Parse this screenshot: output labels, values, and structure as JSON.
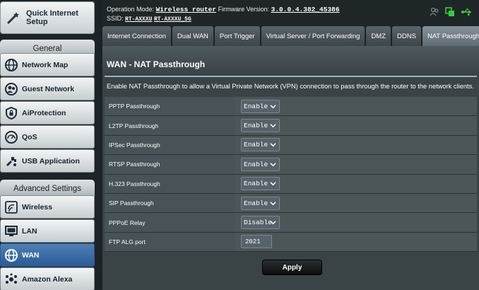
{
  "header": {
    "operation_mode_label": "Operation Mode:",
    "operation_mode_value": "Wireless router",
    "firmware_label": "Firmware Version:",
    "firmware_value": "3.0.0.4.382_45386",
    "ssid_label": "SSID:",
    "ssid_1": "RT-AXXXU",
    "ssid_2": "RT-AXXXU_5G"
  },
  "sidebar": {
    "quick_setup": "Quick Internet Setup",
    "general_title": "General",
    "general_items": [
      {
        "label": "Network Map",
        "icon": "globe-icon"
      },
      {
        "label": "Guest Network",
        "icon": "guest-network-icon"
      },
      {
        "label": "AiProtection",
        "icon": "lock-shield-icon"
      },
      {
        "label": "QoS",
        "icon": "speedometer-icon"
      },
      {
        "label": "USB Application",
        "icon": "puzzle-icon"
      }
    ],
    "advanced_title": "Advanced Settings",
    "advanced_items": [
      {
        "label": "Wireless",
        "icon": "wireless-icon"
      },
      {
        "label": "LAN",
        "icon": "monitor-icon"
      },
      {
        "label": "WAN",
        "icon": "globe-icon",
        "active": true
      },
      {
        "label": "Amazon Alexa",
        "icon": "alexa-icon"
      }
    ]
  },
  "tabs": [
    {
      "label": "Internet Connection"
    },
    {
      "label": "Dual WAN"
    },
    {
      "label": "Port Trigger"
    },
    {
      "label": "Virtual Server / Port Forwarding"
    },
    {
      "label": "DMZ"
    },
    {
      "label": "DDNS"
    },
    {
      "label": "NAT Passthrough",
      "active": true
    }
  ],
  "main": {
    "title": "WAN - NAT Passthrough",
    "description": "Enable NAT Passthrough to allow a Virtual Private Network (VPN) connection to pass through the router to the network clients.",
    "rows": [
      {
        "label": "PPTP Passthrough",
        "value": "Enable"
      },
      {
        "label": "L2TP Passthrough",
        "value": "Enable"
      },
      {
        "label": "IPSec Passthrough",
        "value": "Enable"
      },
      {
        "label": "RTSP Passthrough",
        "value": "Enable"
      },
      {
        "label": "H.323 Passthrough",
        "value": "Enable"
      },
      {
        "label": "SIP Passthrough",
        "value": "Enable"
      },
      {
        "label": "PPPoE Relay",
        "value": "Disable"
      }
    ],
    "ftp_alg_label": "FTP ALG port",
    "ftp_alg_value": "2021",
    "apply_label": "Apply"
  },
  "colors": {
    "active_nav": "#2a5c96",
    "status_green": "#2fd13a"
  }
}
